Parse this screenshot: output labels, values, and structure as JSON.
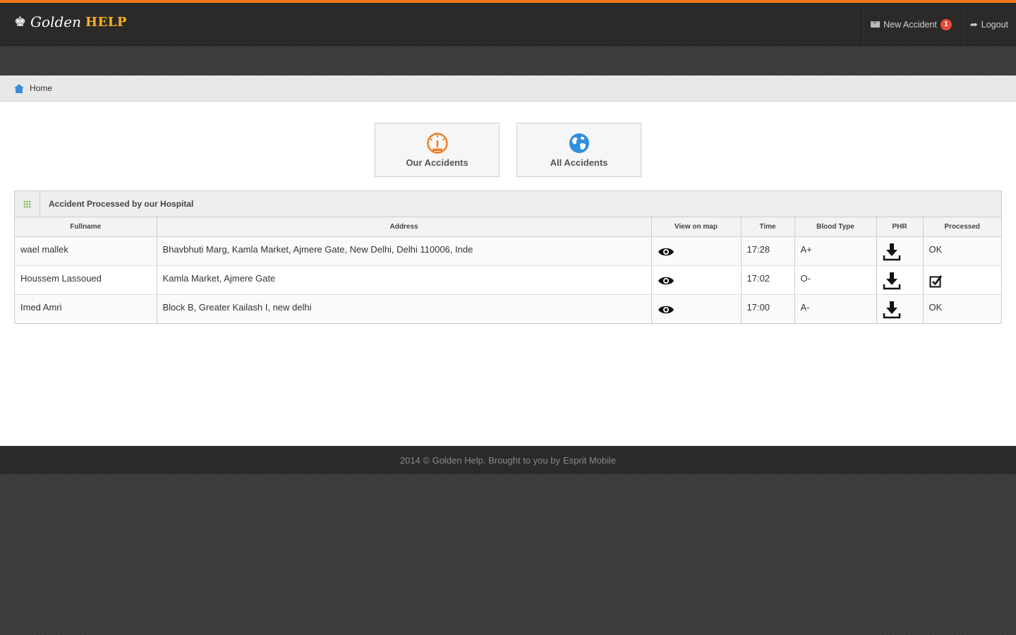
{
  "brand": {
    "name_script": "Golden",
    "name_bold": "HELP"
  },
  "nav": {
    "new_accident_label": "New Accident",
    "new_accident_count": "1",
    "logout_label": "Logout"
  },
  "breadcrumb": {
    "home_label": "Home"
  },
  "tiles": [
    {
      "label": "Our Accidents",
      "icon": "dashboard-gauge-icon",
      "color": "#f07a1d"
    },
    {
      "label": "All Accidents",
      "icon": "globe-icon",
      "color": "#2e8fe0"
    }
  ],
  "widget": {
    "title": "Accident Processed by our Hospital",
    "columns": [
      "Fullname",
      "Address",
      "View on map",
      "Time",
      "Blood Type",
      "PHR",
      "Processed"
    ],
    "rows": [
      {
        "fullname": "wael mallek",
        "address": "Bhavbhuti Marg, Kamla Market, Ajmere Gate, New Delhi, Delhi 110006, Inde",
        "time": "17:28",
        "blood_type": "A+",
        "processed": "OK"
      },
      {
        "fullname": "Houssem Lassoued",
        "address": "Kamla Market, Ajmere Gate",
        "time": "17:02",
        "blood_type": "O-",
        "processed": ""
      },
      {
        "fullname": "Imed Amri",
        "address": "Block B, Greater Kailash I, new delhi",
        "time": "17:00",
        "blood_type": "A-",
        "processed": "OK"
      }
    ]
  },
  "footer": {
    "text": "2014 © Golden Help. Brought to you by",
    "link_label": "Esprit Mobile"
  },
  "colors": {
    "accent": "#f07a1d",
    "brand_help": "#f7b224",
    "badge": "#e74c3c",
    "home_icon": "#3c8dd9",
    "grid_icon": "#6cb33f"
  }
}
